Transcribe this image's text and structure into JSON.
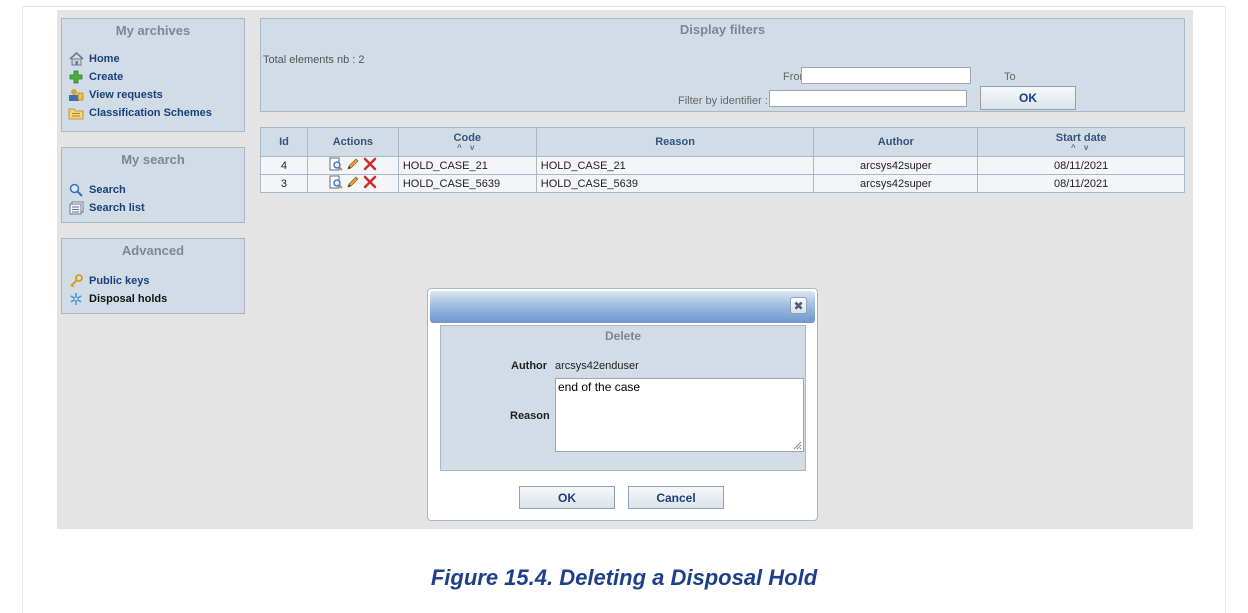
{
  "colors": {
    "accent": "#1a3f7a",
    "panel": "#d2dce6",
    "caption": "#1e3f8a"
  },
  "sidebar": {
    "archives": {
      "title": "My archives",
      "items": [
        {
          "label": "Home",
          "icon": "home-icon"
        },
        {
          "label": "Create",
          "icon": "plus-icon"
        },
        {
          "label": "View requests",
          "icon": "requests-icon"
        },
        {
          "label": "Classification Schemes",
          "icon": "folder-icon"
        }
      ]
    },
    "search": {
      "title": "My search",
      "items": [
        {
          "label": "Search",
          "icon": "search-icon"
        },
        {
          "label": "Search list",
          "icon": "list-icon"
        }
      ]
    },
    "advanced": {
      "title": "Advanced",
      "items": [
        {
          "label": "Public keys",
          "icon": "key-icon"
        },
        {
          "label": "Disposal holds",
          "icon": "snowflake-icon"
        }
      ]
    }
  },
  "filters": {
    "title": "Display filters",
    "total": "Total elements nb :  2",
    "from_label": "From",
    "to_label": "To",
    "identifier_label": "Filter by identifier :",
    "ok_label": "OK"
  },
  "table": {
    "headers": {
      "id": "Id",
      "actions": "Actions",
      "code": "Code",
      "reason": "Reason",
      "author": "Author",
      "start": "Start date"
    },
    "sort_glyph": "^ v",
    "rows": [
      {
        "id": "4",
        "code": "HOLD_CASE_21",
        "reason": "HOLD_CASE_21",
        "author": "arcsys42super",
        "start": "08/11/2021"
      },
      {
        "id": "3",
        "code": "HOLD_CASE_5639",
        "reason": "HOLD_CASE_5639",
        "author": "arcsys42super",
        "start": "08/11/2021"
      }
    ]
  },
  "dialog": {
    "close_glyph": "✖",
    "heading": "Delete",
    "author_label": "Author",
    "author_value": "arcsys42enduser",
    "reason_label": "Reason",
    "reason_value": "end of the case",
    "ok_label": "OK",
    "cancel_label": "Cancel"
  },
  "caption": "Figure 15.4. Deleting a Disposal Hold"
}
